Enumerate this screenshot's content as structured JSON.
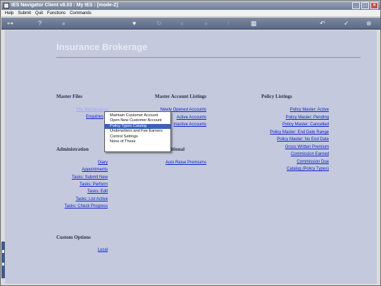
{
  "window": {
    "title": "IES Navigator Client v8.03 : My IES :       [mode-Z]",
    "buttons": [
      "_",
      "□",
      "×"
    ]
  },
  "menubar": [
    "Help",
    "Submit",
    "Quit",
    "Functions",
    "Commands"
  ],
  "toolbar": {
    "icons": [
      "key-icon",
      "help-icon",
      "search-icon",
      "heart-icon",
      "refresh-icon",
      "back-icon",
      "forward-icon",
      "up-icon",
      "grid-icon",
      "undo-icon",
      "check-icon",
      "close-icon"
    ]
  },
  "page": {
    "title": "Insurance Brokerage"
  },
  "master_files": {
    "header": "Master Files",
    "items": [
      "File Maintenance",
      "Enquiries"
    ]
  },
  "administration": {
    "header": "Administration",
    "items": [
      "Diary",
      "Appointments",
      "Tasks: Submit New",
      "Tasks: Perform",
      "Tasks: Edit",
      "Tasks: List Active",
      "Tasks: Check Progress"
    ]
  },
  "custom_options": {
    "header": "Custom Options",
    "items": [
      "Local"
    ]
  },
  "master_account_listings": {
    "header": "Master Account Listings",
    "items": [
      "Newly Opened Accounts",
      "Active Accounts",
      "Inactive Accounts"
    ]
  },
  "middle_section": {
    "header": "itional",
    "items": [
      "Auto Raise Premiums"
    ]
  },
  "policy_listings": {
    "header": "Policy Listings",
    "items": [
      "Policy Master: Active",
      "Policy Master: Pending",
      "Policy Master: Cancelled",
      "Policy Master: End Date Range",
      "Policy Master: No End Date",
      "Gross Written Premium",
      "Commission Earned",
      "Commission Due",
      "Catalog (Policy Types)"
    ]
  },
  "popup_menu": {
    "items": [
      "Maintain Customer Account",
      "Open New Customer Account",
      "Policy Types Catalog",
      "Underwriters and Fee Earners",
      "Control Settings",
      "None of These"
    ],
    "selected_index": 2
  }
}
